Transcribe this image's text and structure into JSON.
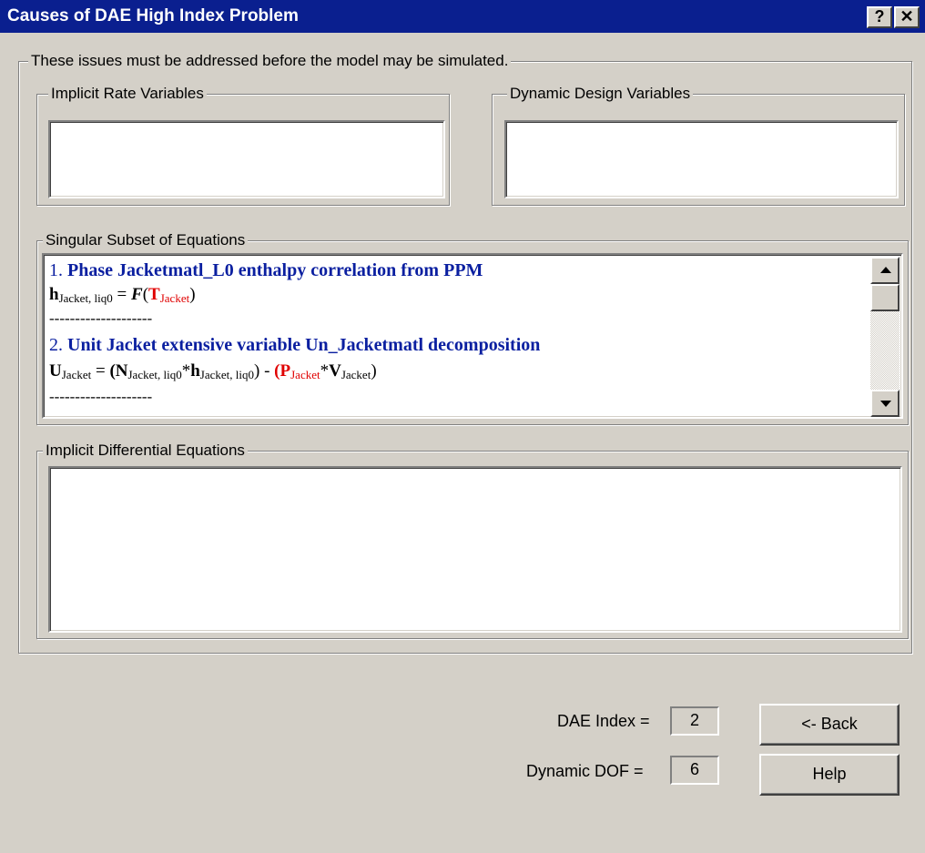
{
  "window": {
    "title": "Causes of DAE High Index Problem",
    "help_glyph": "?",
    "close_glyph": "✕"
  },
  "outer_group": {
    "label": "These issues must be addressed before the model may be simulated."
  },
  "implicit_rate": {
    "label": "Implicit Rate Variables"
  },
  "dynamic_design": {
    "label": "Dynamic Design Variables"
  },
  "singular_subset": {
    "label": "Singular Subset of Equations",
    "items": [
      {
        "number": "1.",
        "heading": "Phase Jacketmatl_L0 enthalpy correlation from PPM",
        "eq": {
          "h": "h",
          "h_sub": "Jacket, liq0",
          "eq_sign": " = ",
          "func": "F",
          "open": "(",
          "T": "T",
          "T_sub": "Jacket",
          "close": ")"
        }
      },
      {
        "number": "2.",
        "heading": "Unit Jacket extensive variable Un_Jacketmatl decomposition",
        "eq": {
          "U": "U",
          "U_sub": "Jacket",
          "eq_sign": " = ",
          "p1": "(",
          "N": "N",
          "N_sub": "Jacket, liq0",
          "star1": "*",
          "h": "h",
          "h_sub": "Jacket, liq0",
          "p2": ") - ",
          "p3": "(",
          "P": "P",
          "P_sub": "Jacket",
          "star2": "*",
          "V": "V",
          "V_sub": "Jacket",
          "p4": ")"
        }
      }
    ],
    "separator": "--------------------"
  },
  "implicit_diff": {
    "label": "Implicit Differential Equations"
  },
  "dae_index": {
    "label": "DAE Index =",
    "value": "2"
  },
  "dynamic_dof": {
    "label": "Dynamic DOF =",
    "value": "6"
  },
  "buttons": {
    "back": "<- Back",
    "help": "Help"
  }
}
